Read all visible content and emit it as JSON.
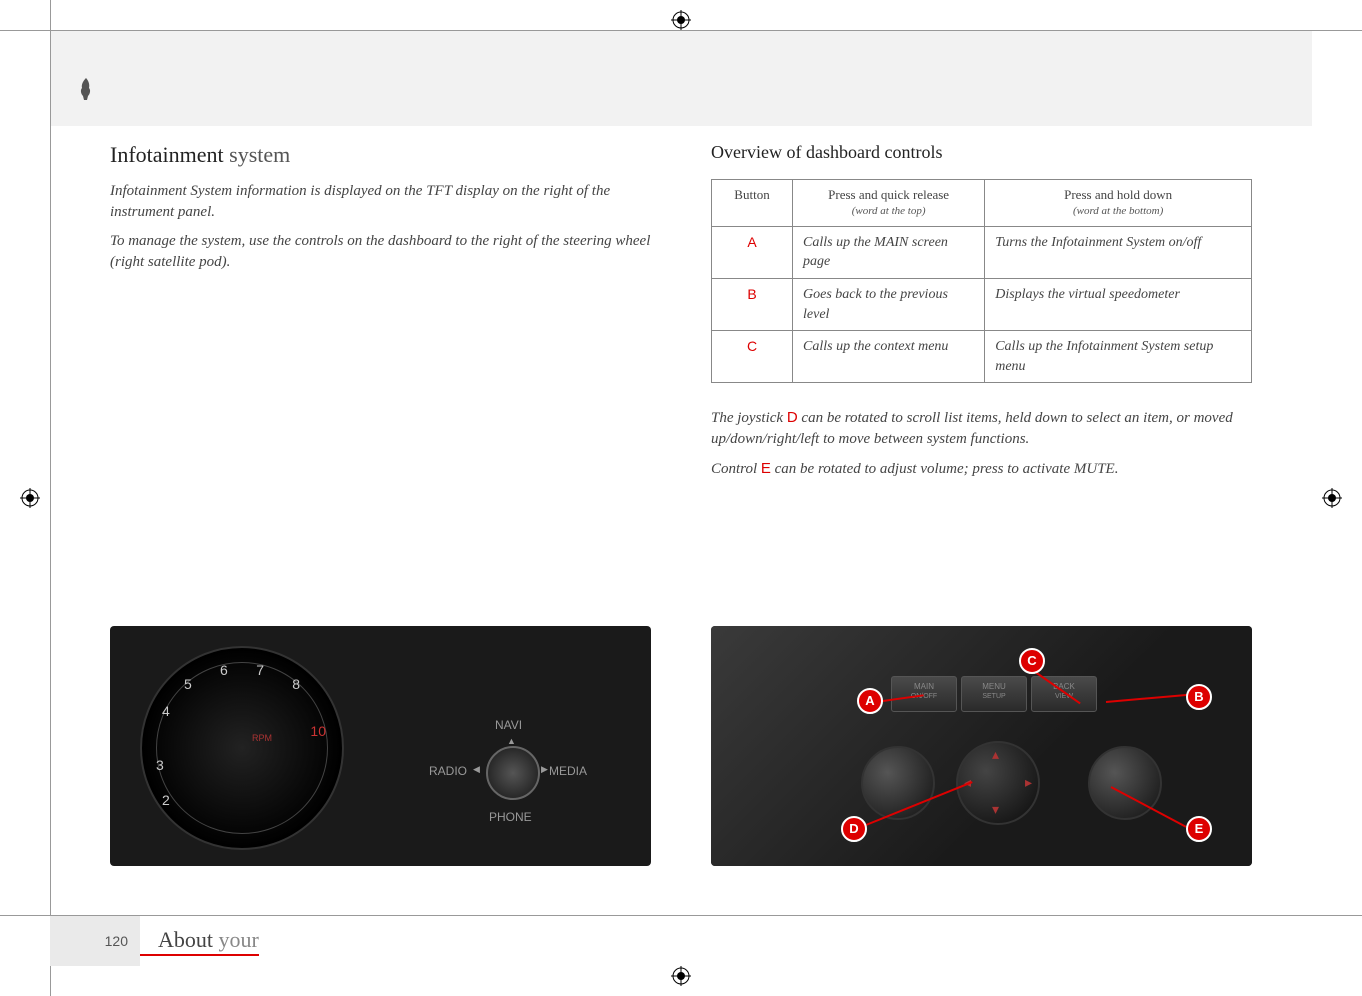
{
  "left": {
    "heading_main": "Infotainment",
    "heading_sub": "system",
    "p1": "Infotainment System information is displayed on the TFT display on the right of the instrument panel.",
    "p2": "To manage the system, use the controls on the dashboard to the right of the steering wheel (right satellite pod)."
  },
  "right": {
    "heading": "Overview",
    "heading_sub": "of dashboard controls",
    "table": {
      "h1": "Button",
      "h2": "Press and quick release",
      "h2_sub": "(word at the top)",
      "h3": "Press and hold down",
      "h3_sub": "(word at the bottom)",
      "rows": [
        {
          "btn": "A",
          "press": "Calls up the MAIN screen page",
          "hold": "Turns the Infotainment System on/off"
        },
        {
          "btn": "B",
          "press": "Goes back to the previous level",
          "hold": "Displays the virtual speedometer"
        },
        {
          "btn": "C",
          "press": "Calls up the context menu",
          "hold": "Calls up the Infotainment System setup menu"
        }
      ]
    },
    "joy_pre": "The joystick ",
    "joy_letter": "D",
    "joy_post": " can be rotated to scroll list items, held down to select an item, or moved up/down/right/left to move between system functions.",
    "ctrl_pre": "Control ",
    "ctrl_letter": "E",
    "ctrl_post": " can be rotated to adjust volume; press to activate MUTE."
  },
  "img_left": {
    "nav_top": "NAVI",
    "nav_left": "RADIO",
    "nav_right": "MEDIA",
    "nav_bottom": "PHONE",
    "gauge_nums": [
      "2",
      "3",
      "4",
      "5",
      "6",
      "7",
      "8",
      "10"
    ],
    "rpm_label": "RPM"
  },
  "img_right": {
    "btn1_top": "MAIN",
    "btn1_bot": "ON/OFF",
    "btn2_top": "MENU",
    "btn2_bot": "SETUP",
    "btn3_top": "BACK",
    "btn3_bot": "VIEW",
    "callouts": {
      "A": "A",
      "B": "B",
      "C": "C",
      "D": "D",
      "E": "E"
    }
  },
  "footer": {
    "page": "120",
    "title_main": "About",
    "title_sub": "your"
  }
}
